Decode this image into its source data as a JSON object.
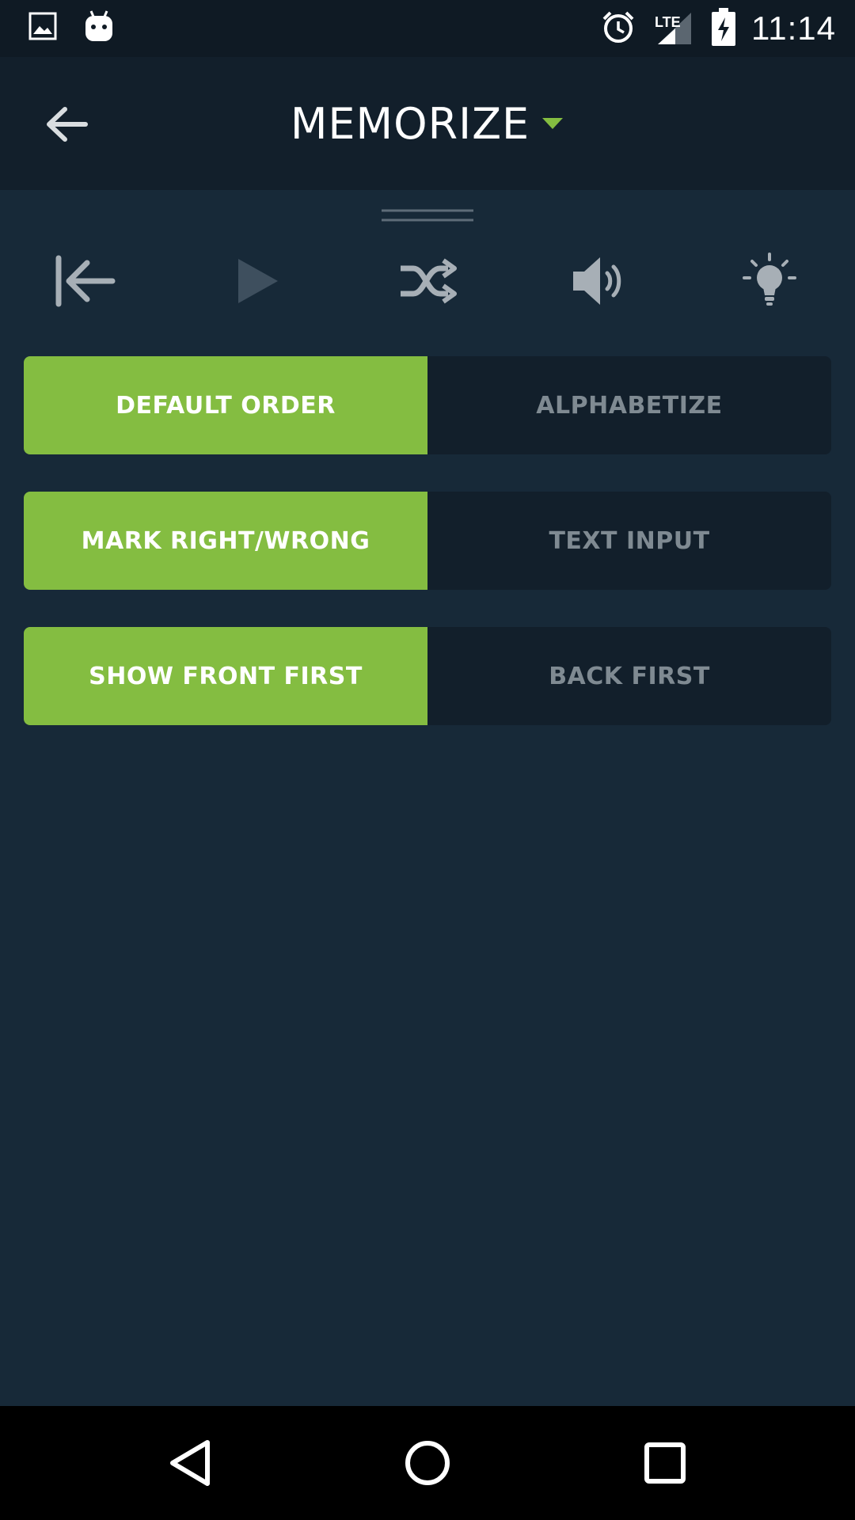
{
  "status_bar": {
    "time": "11:14",
    "network": "LTE",
    "icons": [
      "image-icon",
      "android-icon",
      "alarm-icon",
      "signal-icon",
      "battery-charging-icon"
    ]
  },
  "app_bar": {
    "title": "MEMORIZE",
    "accent_color": "#84bd41"
  },
  "controls": [
    "restart-icon",
    "play-icon",
    "shuffle-icon",
    "volume-icon",
    "lightbulb-icon"
  ],
  "toggles": [
    {
      "active": "DEFAULT ORDER",
      "inactive": "ALPHABETIZE"
    },
    {
      "active": "MARK RIGHT/WRONG",
      "inactive": "TEXT INPUT"
    },
    {
      "active": "SHOW FRONT FIRST",
      "inactive": "BACK FIRST"
    }
  ],
  "colors": {
    "background": "#172938",
    "app_bar": "#121f2b",
    "active_segment": "#84bd41",
    "inactive_text": "#7f8a92"
  },
  "nav_bar": [
    "back-triangle-icon",
    "home-circle-icon",
    "recents-square-icon"
  ]
}
